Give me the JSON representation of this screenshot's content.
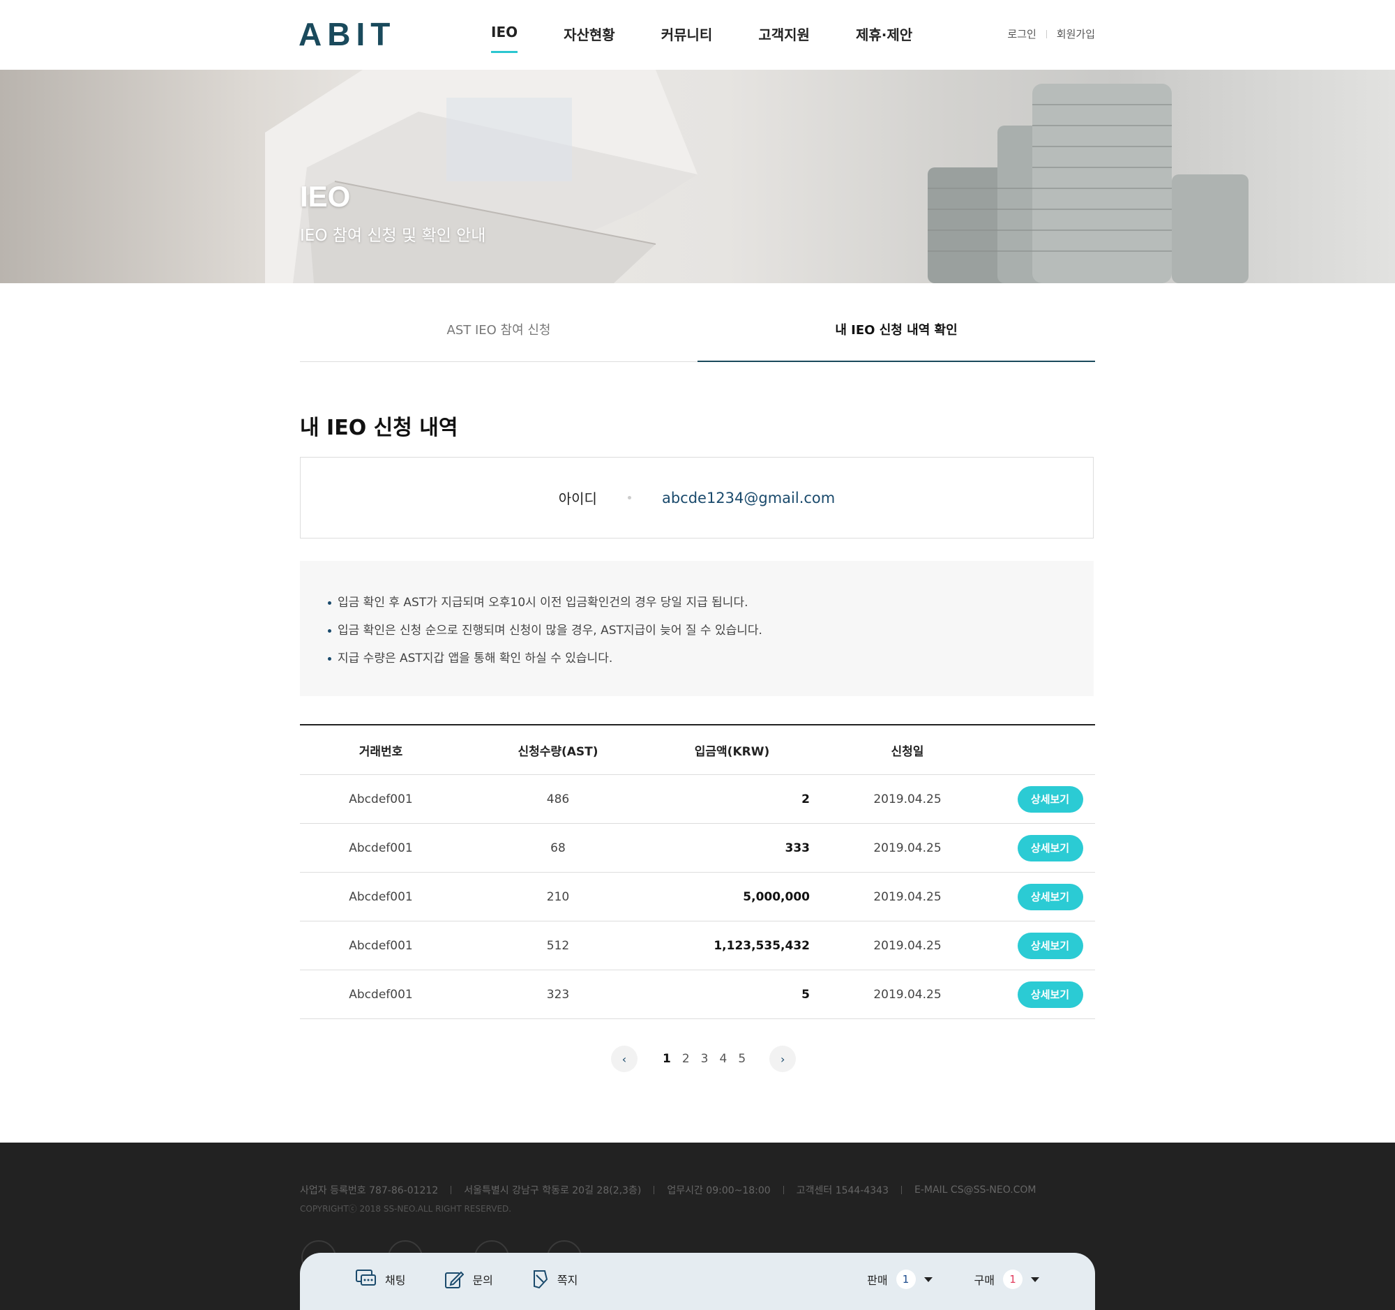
{
  "header": {
    "logo": "ABIT",
    "nav": [
      "IEO",
      "자산현황",
      "커뮤니티",
      "고객지원",
      "제휴·제안"
    ],
    "login": "로그인",
    "signup": "회원가입"
  },
  "hero": {
    "title": "IEO",
    "subtitle": "IEO 참여 신청 및 확인 안내"
  },
  "tabs": [
    "AST IEO 참여 신청",
    "내 IEO 신청 내역 확인"
  ],
  "section": {
    "title": "내 IEO 신청 내역",
    "id_label": "아이디",
    "id_value": "abcde1234@gmail.com"
  },
  "notices": [
    "입금 확인 후 AST가 지급되며 오후10시 이전 입금확인건의 경우 당일 지급 됩니다.",
    "입금 확인은 신청 순으로 진행되며 신청이 많을 경우, AST지급이 늦어 질 수 있습니다.",
    "지급 수량은 AST지갑 앱을 통해 확인 하실 수 있습니다."
  ],
  "table": {
    "headers": [
      "거래번호",
      "신청수량(AST)",
      "입금액(KRW)",
      "신청일"
    ],
    "detail_label": "상세보기",
    "rows": [
      {
        "id": "Abcdef001",
        "qty": "486",
        "amount": "2",
        "date": "2019.04.25"
      },
      {
        "id": "Abcdef001",
        "qty": "68",
        "amount": "333",
        "date": "2019.04.25"
      },
      {
        "id": "Abcdef001",
        "qty": "210",
        "amount": "5,000,000",
        "date": "2019.04.25"
      },
      {
        "id": "Abcdef001",
        "qty": "512",
        "amount": "1,123,535,432",
        "date": "2019.04.25"
      },
      {
        "id": "Abcdef001",
        "qty": "323",
        "amount": "5",
        "date": "2019.04.25"
      }
    ]
  },
  "pagination": {
    "prev": "‹",
    "next": "›",
    "pages": [
      "1",
      "2",
      "3",
      "4",
      "5"
    ],
    "current": "1"
  },
  "footer": {
    "info": [
      "사업자 등록번호 787-86-01212",
      "서울특별시 강남구 학동로 20길 28(2,3층)",
      "업무시간 09:00~18:00",
      "고객센터 1544-4343",
      "E-MAIL  CS@SS-NEO.COM"
    ],
    "copyright": "COPYRIGHTⓒ 2018 SS-NEO.ALL RIGHT RESERVED."
  },
  "floatbar": {
    "chat": "채팅",
    "inquiry": "문의",
    "memo": "쪽지",
    "sell_label": "판매",
    "sell_count": "1",
    "buy_label": "구매",
    "buy_count": "1"
  },
  "colors": {
    "accent": "#2bcbd4",
    "brand": "#1a4a5c",
    "footer_bg": "#222222",
    "floatbar_bg": "#e5ecf1"
  }
}
